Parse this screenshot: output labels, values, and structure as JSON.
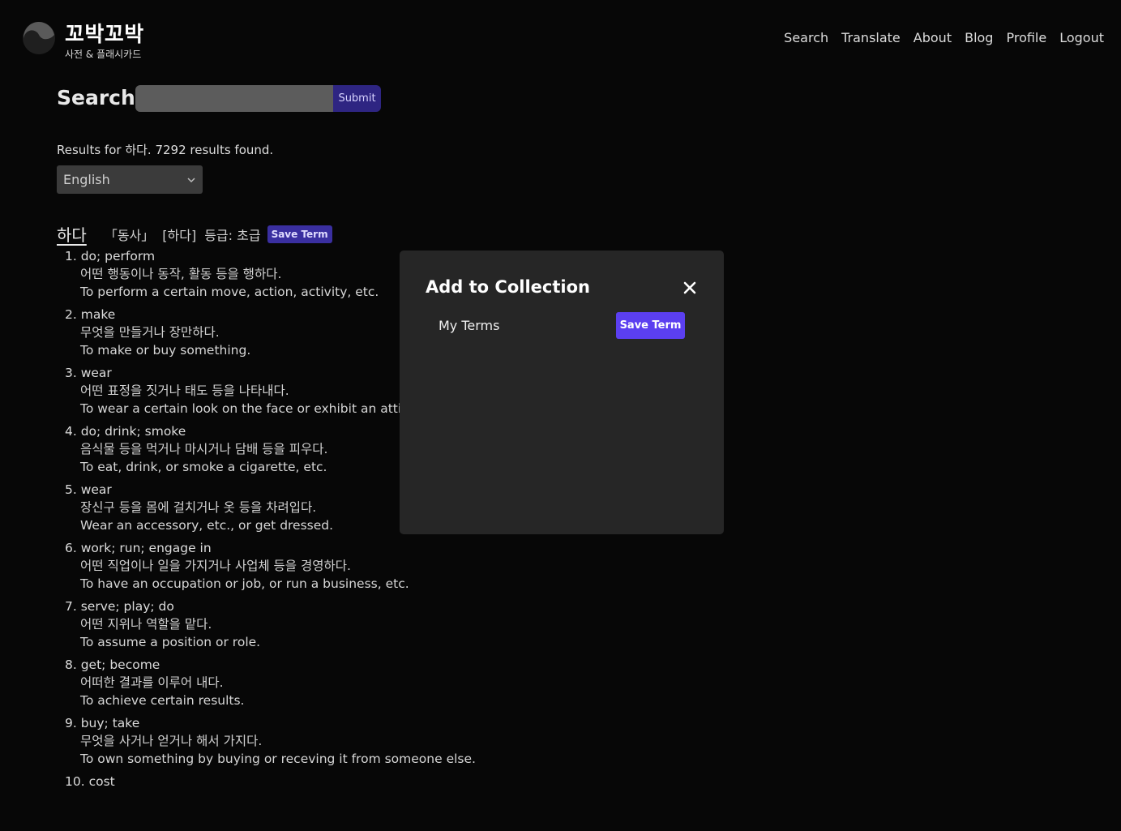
{
  "header": {
    "brand_title": "꼬박꼬박",
    "brand_subtitle": "사전 & 플래시카드",
    "nav": [
      "Search",
      "Translate",
      "About",
      "Blog",
      "Profile",
      "Logout"
    ]
  },
  "search": {
    "title": "Search",
    "input_value": "",
    "submit_label": "Submit",
    "results_summary": "Results for 하다. 7292 results found.",
    "language_selected": "English"
  },
  "entry": {
    "headword": "하다",
    "part_of_speech": "「동사」",
    "pronunciation": "[하다]",
    "level": "등급: 초급",
    "save_label": "Save Term",
    "senses": [
      {
        "gloss": "1. do; perform",
        "ko": "어떤 행동이나 동작, 활동 등을 행하다.",
        "en": "To perform a certain move, action, activity, etc."
      },
      {
        "gloss": "2. make",
        "ko": "무엇을 만들거나 장만하다.",
        "en": "To make or buy something."
      },
      {
        "gloss": "3. wear",
        "ko": "어떤 표정을 짓거나 태도 등을 나타내다.",
        "en": "To wear a certain look on the face or exhibit an attitu"
      },
      {
        "gloss": "4. do; drink; smoke",
        "ko": "음식물 등을 먹거나 마시거나 담배 등을 피우다.",
        "en": "To eat, drink, or smoke a cigarette, etc."
      },
      {
        "gloss": "5. wear",
        "ko": "장신구 등을 몸에 걸치거나 옷 등을 차려입다.",
        "en": "Wear an accessory, etc., or get dressed."
      },
      {
        "gloss": "6. work; run; engage in",
        "ko": "어떤 직업이나 일을 가지거나 사업체 등을 경영하다.",
        "en": "To have an occupation or job, or run a business, etc."
      },
      {
        "gloss": "7. serve; play; do",
        "ko": "어떤 지위나 역할을 맡다.",
        "en": "To assume a position or role."
      },
      {
        "gloss": "8. get; become",
        "ko": "어떠한 결과를 이루어 내다.",
        "en": "To achieve certain results."
      },
      {
        "gloss": "9. buy; take",
        "ko": "무엇을 사거나 얻거나 해서 가지다.",
        "en": "To own something by buying or receving it from someone else."
      },
      {
        "gloss": "10. cost",
        "ko": "",
        "en": ""
      }
    ]
  },
  "modal": {
    "title": "Add to Collection",
    "collections": [
      {
        "name": "My Terms",
        "save_label": "Save Term"
      }
    ]
  }
}
